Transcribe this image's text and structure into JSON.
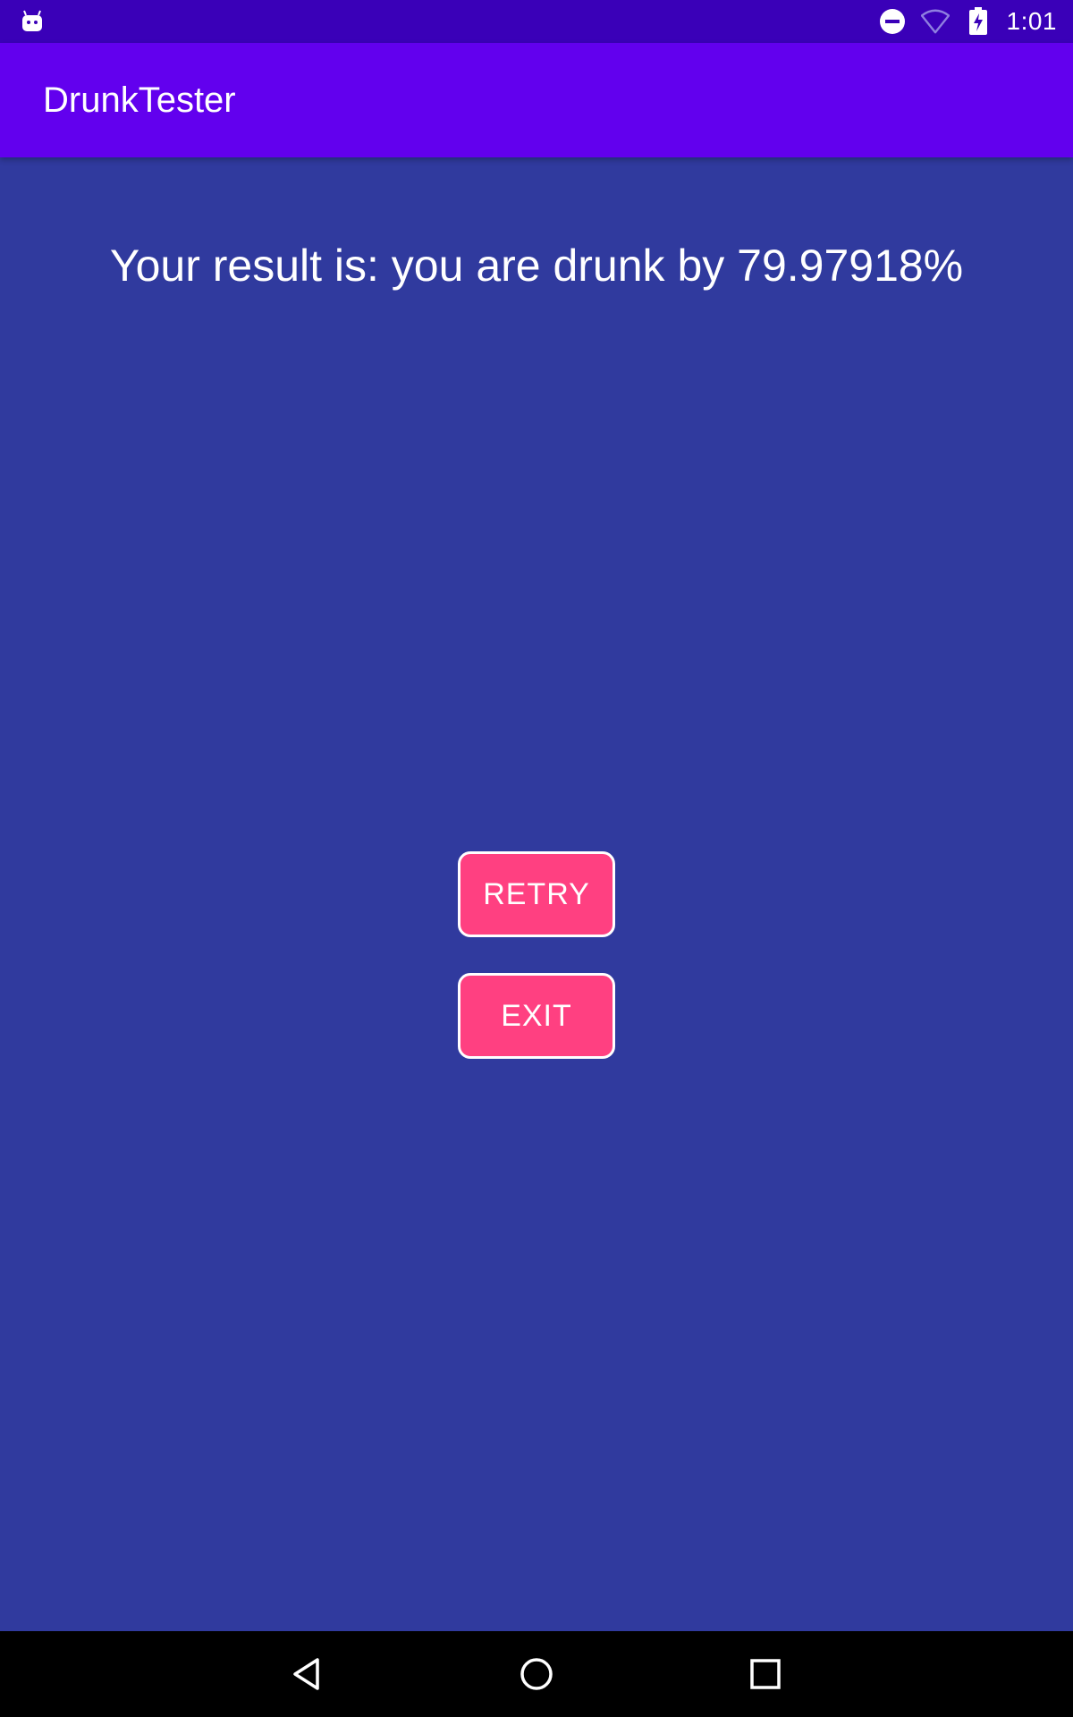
{
  "status_bar": {
    "time": "1:01",
    "left_icon": "android-notification-icon",
    "icons": [
      "do-not-disturb-icon",
      "wifi-icon",
      "battery-charging-icon"
    ]
  },
  "app_bar": {
    "title": "DrunkTester"
  },
  "main": {
    "result_text": "Your result is: you are drunk by 79.97918%",
    "retry_label": "RETRY",
    "exit_label": "EXIT"
  },
  "nav_bar": {
    "icons": [
      "back-icon",
      "home-icon",
      "recents-icon"
    ]
  },
  "colors": {
    "status_bar": "#3A00B8",
    "app_bar": "#6200EE",
    "background": "#303A9E",
    "button": "#FF4081",
    "button_border": "#FFFFFF",
    "nav_bar": "#000000"
  }
}
